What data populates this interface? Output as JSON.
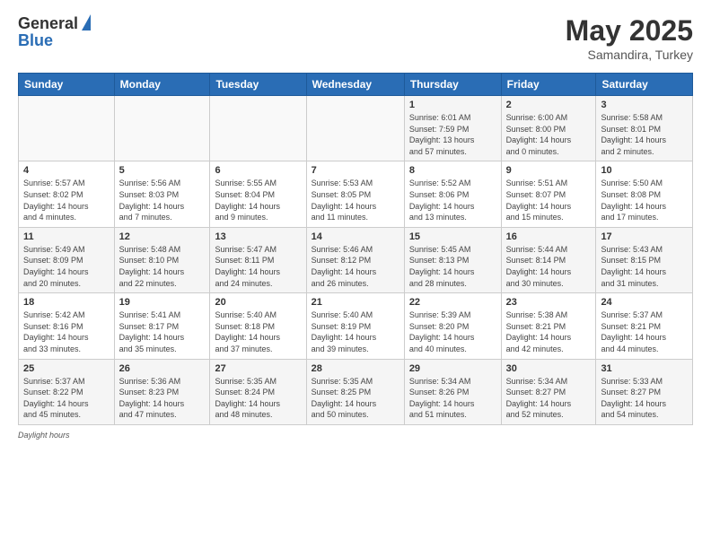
{
  "header": {
    "logo_general": "General",
    "logo_blue": "Blue",
    "main_title": "May 2025",
    "subtitle": "Samandira, Turkey"
  },
  "days_of_week": [
    "Sunday",
    "Monday",
    "Tuesday",
    "Wednesday",
    "Thursday",
    "Friday",
    "Saturday"
  ],
  "footer": {
    "note": "Daylight hours"
  },
  "weeks": [
    [
      {
        "day": "",
        "info": ""
      },
      {
        "day": "",
        "info": ""
      },
      {
        "day": "",
        "info": ""
      },
      {
        "day": "",
        "info": ""
      },
      {
        "day": "1",
        "info": "Sunrise: 6:01 AM\nSunset: 7:59 PM\nDaylight: 13 hours\nand 57 minutes."
      },
      {
        "day": "2",
        "info": "Sunrise: 6:00 AM\nSunset: 8:00 PM\nDaylight: 14 hours\nand 0 minutes."
      },
      {
        "day": "3",
        "info": "Sunrise: 5:58 AM\nSunset: 8:01 PM\nDaylight: 14 hours\nand 2 minutes."
      }
    ],
    [
      {
        "day": "4",
        "info": "Sunrise: 5:57 AM\nSunset: 8:02 PM\nDaylight: 14 hours\nand 4 minutes."
      },
      {
        "day": "5",
        "info": "Sunrise: 5:56 AM\nSunset: 8:03 PM\nDaylight: 14 hours\nand 7 minutes."
      },
      {
        "day": "6",
        "info": "Sunrise: 5:55 AM\nSunset: 8:04 PM\nDaylight: 14 hours\nand 9 minutes."
      },
      {
        "day": "7",
        "info": "Sunrise: 5:53 AM\nSunset: 8:05 PM\nDaylight: 14 hours\nand 11 minutes."
      },
      {
        "day": "8",
        "info": "Sunrise: 5:52 AM\nSunset: 8:06 PM\nDaylight: 14 hours\nand 13 minutes."
      },
      {
        "day": "9",
        "info": "Sunrise: 5:51 AM\nSunset: 8:07 PM\nDaylight: 14 hours\nand 15 minutes."
      },
      {
        "day": "10",
        "info": "Sunrise: 5:50 AM\nSunset: 8:08 PM\nDaylight: 14 hours\nand 17 minutes."
      }
    ],
    [
      {
        "day": "11",
        "info": "Sunrise: 5:49 AM\nSunset: 8:09 PM\nDaylight: 14 hours\nand 20 minutes."
      },
      {
        "day": "12",
        "info": "Sunrise: 5:48 AM\nSunset: 8:10 PM\nDaylight: 14 hours\nand 22 minutes."
      },
      {
        "day": "13",
        "info": "Sunrise: 5:47 AM\nSunset: 8:11 PM\nDaylight: 14 hours\nand 24 minutes."
      },
      {
        "day": "14",
        "info": "Sunrise: 5:46 AM\nSunset: 8:12 PM\nDaylight: 14 hours\nand 26 minutes."
      },
      {
        "day": "15",
        "info": "Sunrise: 5:45 AM\nSunset: 8:13 PM\nDaylight: 14 hours\nand 28 minutes."
      },
      {
        "day": "16",
        "info": "Sunrise: 5:44 AM\nSunset: 8:14 PM\nDaylight: 14 hours\nand 30 minutes."
      },
      {
        "day": "17",
        "info": "Sunrise: 5:43 AM\nSunset: 8:15 PM\nDaylight: 14 hours\nand 31 minutes."
      }
    ],
    [
      {
        "day": "18",
        "info": "Sunrise: 5:42 AM\nSunset: 8:16 PM\nDaylight: 14 hours\nand 33 minutes."
      },
      {
        "day": "19",
        "info": "Sunrise: 5:41 AM\nSunset: 8:17 PM\nDaylight: 14 hours\nand 35 minutes."
      },
      {
        "day": "20",
        "info": "Sunrise: 5:40 AM\nSunset: 8:18 PM\nDaylight: 14 hours\nand 37 minutes."
      },
      {
        "day": "21",
        "info": "Sunrise: 5:40 AM\nSunset: 8:19 PM\nDaylight: 14 hours\nand 39 minutes."
      },
      {
        "day": "22",
        "info": "Sunrise: 5:39 AM\nSunset: 8:20 PM\nDaylight: 14 hours\nand 40 minutes."
      },
      {
        "day": "23",
        "info": "Sunrise: 5:38 AM\nSunset: 8:21 PM\nDaylight: 14 hours\nand 42 minutes."
      },
      {
        "day": "24",
        "info": "Sunrise: 5:37 AM\nSunset: 8:21 PM\nDaylight: 14 hours\nand 44 minutes."
      }
    ],
    [
      {
        "day": "25",
        "info": "Sunrise: 5:37 AM\nSunset: 8:22 PM\nDaylight: 14 hours\nand 45 minutes."
      },
      {
        "day": "26",
        "info": "Sunrise: 5:36 AM\nSunset: 8:23 PM\nDaylight: 14 hours\nand 47 minutes."
      },
      {
        "day": "27",
        "info": "Sunrise: 5:35 AM\nSunset: 8:24 PM\nDaylight: 14 hours\nand 48 minutes."
      },
      {
        "day": "28",
        "info": "Sunrise: 5:35 AM\nSunset: 8:25 PM\nDaylight: 14 hours\nand 50 minutes."
      },
      {
        "day": "29",
        "info": "Sunrise: 5:34 AM\nSunset: 8:26 PM\nDaylight: 14 hours\nand 51 minutes."
      },
      {
        "day": "30",
        "info": "Sunrise: 5:34 AM\nSunset: 8:27 PM\nDaylight: 14 hours\nand 52 minutes."
      },
      {
        "day": "31",
        "info": "Sunrise: 5:33 AM\nSunset: 8:27 PM\nDaylight: 14 hours\nand 54 minutes."
      }
    ]
  ]
}
